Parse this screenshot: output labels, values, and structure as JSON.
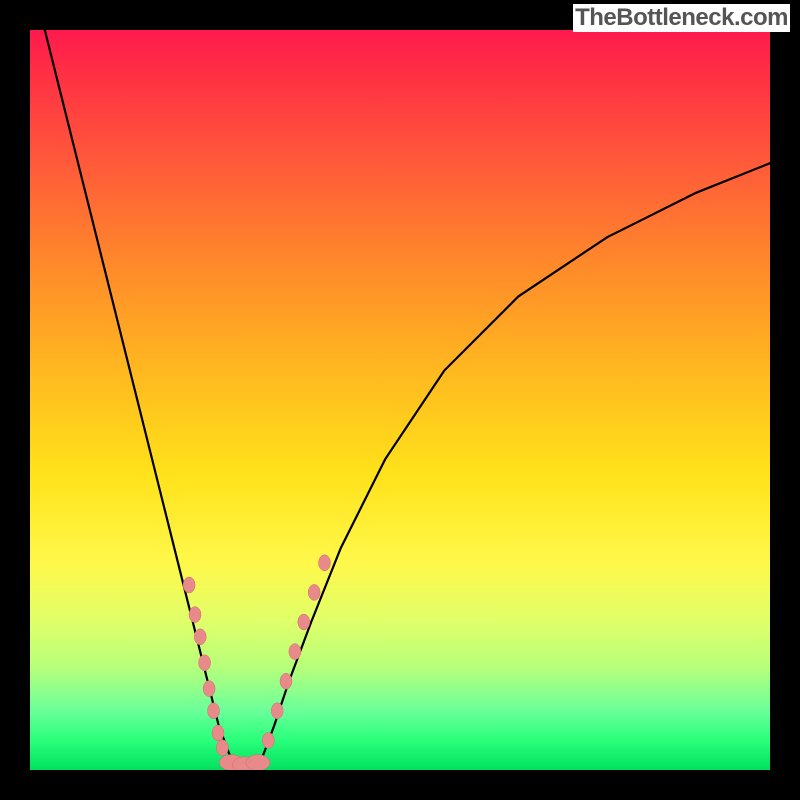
{
  "watermark": "TheBottleneck.com",
  "colors": {
    "frame": "#000000",
    "curve": "#000000",
    "marker_fill": "#e88a8a",
    "marker_stroke": "#d46a6a"
  },
  "chart_data": {
    "type": "line",
    "title": "",
    "xlabel": "",
    "ylabel": "",
    "xlim": [
      0,
      100
    ],
    "ylim": [
      0,
      100
    ],
    "grid": false,
    "series": [
      {
        "name": "bottleneck-curve",
        "x": [
          2,
          4,
          6,
          8,
          10,
          12,
          14,
          16,
          18,
          20,
          22,
          23.5,
          24.5,
          25.5,
          27,
          28.5,
          30,
          31.5,
          33,
          35,
          38,
          42,
          48,
          56,
          66,
          78,
          90,
          100
        ],
        "y": [
          100,
          92,
          84,
          76,
          68,
          60,
          52,
          44,
          36,
          28,
          20,
          14,
          10,
          6,
          2,
          0.8,
          0.6,
          2,
          6,
          12,
          20,
          30,
          42,
          54,
          64,
          72,
          78,
          82
        ]
      }
    ],
    "markers": {
      "name": "data-points",
      "points": [
        {
          "x": 21.5,
          "y": 25
        },
        {
          "x": 22.3,
          "y": 21
        },
        {
          "x": 23.0,
          "y": 18
        },
        {
          "x": 23.6,
          "y": 14.5
        },
        {
          "x": 24.2,
          "y": 11
        },
        {
          "x": 24.8,
          "y": 8
        },
        {
          "x": 25.4,
          "y": 5
        },
        {
          "x": 26.0,
          "y": 3
        },
        {
          "x": 27.2,
          "y": 1.0,
          "wide": true
        },
        {
          "x": 29.0,
          "y": 0.7,
          "wide": true
        },
        {
          "x": 30.8,
          "y": 1.0,
          "wide": true
        },
        {
          "x": 32.2,
          "y": 4
        },
        {
          "x": 33.4,
          "y": 8
        },
        {
          "x": 34.6,
          "y": 12
        },
        {
          "x": 35.8,
          "y": 16
        },
        {
          "x": 37.0,
          "y": 20
        },
        {
          "x": 38.4,
          "y": 24
        },
        {
          "x": 39.8,
          "y": 28
        }
      ]
    }
  }
}
